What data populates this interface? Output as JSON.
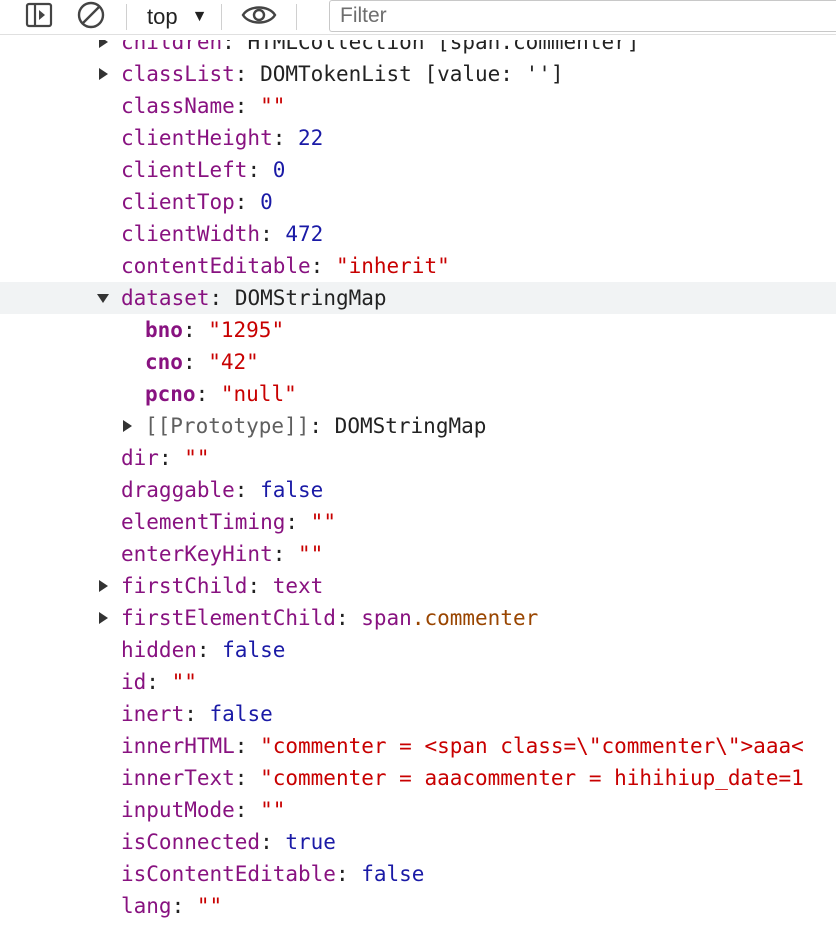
{
  "toolbar": {
    "context_label": "top",
    "filter_placeholder": "Filter",
    "icons": [
      "sidebar-toggle-icon",
      "clear-console-icon",
      "eye-icon"
    ]
  },
  "tree": {
    "partial_row": {
      "key": "children",
      "sep": ": ",
      "value": "HTMLCollection [span.commenter]"
    },
    "rows": [
      {
        "key": "classList",
        "sep": ": ",
        "value": "DOMTokenList [value: '']"
      },
      {
        "key": "className",
        "sep": ": ",
        "value": "\"\""
      },
      {
        "key": "clientHeight",
        "sep": ": ",
        "value": "22"
      },
      {
        "key": "clientLeft",
        "sep": ": ",
        "value": "0"
      },
      {
        "key": "clientTop",
        "sep": ": ",
        "value": "0"
      },
      {
        "key": "clientWidth",
        "sep": ": ",
        "value": "472"
      },
      {
        "key": "contentEditable",
        "sep": ": ",
        "value": "\"inherit\""
      },
      {
        "key": "dataset",
        "sep": ": ",
        "value": "DOMStringMap"
      },
      {
        "key": "bno",
        "sep": ": ",
        "value": "\"1295\""
      },
      {
        "key": "cno",
        "sep": ": ",
        "value": "\"42\""
      },
      {
        "key": "pcno",
        "sep": ": ",
        "value": "\"null\""
      },
      {
        "key": "[[Prototype]]",
        "sep": ": ",
        "value": "DOMStringMap"
      },
      {
        "key": "dir",
        "sep": ": ",
        "value": "\"\""
      },
      {
        "key": "draggable",
        "sep": ": ",
        "value": "false"
      },
      {
        "key": "elementTiming",
        "sep": ": ",
        "value": "\"\""
      },
      {
        "key": "enterKeyHint",
        "sep": ": ",
        "value": "\"\""
      },
      {
        "key": "firstChild",
        "sep": ": ",
        "value": "text"
      },
      {
        "key": "firstElementChild",
        "sep": ": ",
        "value_node": "span",
        "value_dot": ".",
        "value_class": "commenter"
      },
      {
        "key": "hidden",
        "sep": ": ",
        "value": "false"
      },
      {
        "key": "id",
        "sep": ": ",
        "value": "\"\""
      },
      {
        "key": "inert",
        "sep": ": ",
        "value": "false"
      },
      {
        "key": "innerHTML",
        "sep": ": ",
        "value": "\"commenter = <span class=\\\"commenter\\\">aaa<"
      },
      {
        "key": "innerText",
        "sep": ": ",
        "value": "\"commenter = aaacommenter = hihihiup_date=1"
      },
      {
        "key": "inputMode",
        "sep": ": ",
        "value": "\"\""
      },
      {
        "key": "isConnected",
        "sep": ": ",
        "value": "true"
      },
      {
        "key": "isContentEditable",
        "sep": ": ",
        "value": "false"
      },
      {
        "key": "lang",
        "sep": ": ",
        "value": "\"\""
      }
    ]
  },
  "colors": {
    "key": "#881280",
    "string": "#c80000",
    "number": "#1a1aa6",
    "class_name": "#994500",
    "highlight_row": "#f1f3f4"
  }
}
